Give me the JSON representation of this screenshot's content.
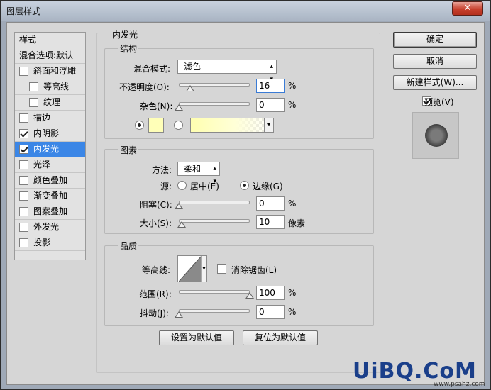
{
  "window": {
    "title": "图层样式",
    "close_glyph": "✕"
  },
  "style_list": {
    "header": "样式",
    "blend_options": "混合选项:默认",
    "items": [
      {
        "label": "斜面和浮雕",
        "checked": false
      },
      {
        "label": "等高线",
        "checked": false
      },
      {
        "label": "纹理",
        "checked": false
      },
      {
        "label": "描边",
        "checked": false
      },
      {
        "label": "内阴影",
        "checked": true
      },
      {
        "label": "内发光",
        "checked": true,
        "selected": true
      },
      {
        "label": "光泽",
        "checked": false
      },
      {
        "label": "颜色叠加",
        "checked": false
      },
      {
        "label": "渐变叠加",
        "checked": false
      },
      {
        "label": "图案叠加",
        "checked": false
      },
      {
        "label": "外发光",
        "checked": false
      },
      {
        "label": "投影",
        "checked": false
      }
    ]
  },
  "inner_glow": {
    "title": "内发光",
    "structure": {
      "title": "结构",
      "blend_mode_label": "混合模式:",
      "blend_mode_value": "滤色",
      "opacity_label": "不透明度(O):",
      "opacity_value": "16",
      "opacity_unit": "%",
      "opacity_level": 0.16,
      "noise_label": "杂色(N):",
      "noise_value": "0",
      "noise_unit": "%",
      "noise_level": 0,
      "color_swatch": "#ffffb8",
      "gradient_arrow": "▾"
    },
    "elements": {
      "title": "图素",
      "technique_label": "方法:",
      "technique_value": "柔和",
      "source_label": "源:",
      "source_center": "居中(E)",
      "source_edge": "边缘(G)",
      "choke_label": "阻塞(C):",
      "choke_value": "0",
      "choke_unit": "%",
      "choke_level": 0,
      "size_label": "大小(S):",
      "size_value": "10",
      "size_unit": "像素",
      "size_level": 0.04
    },
    "quality": {
      "title": "品质",
      "contour_label": "等高线:",
      "antialias_label": "消除锯齿(L)",
      "range_label": "范围(R):",
      "range_value": "100",
      "range_unit": "%",
      "range_level": 1.0,
      "jitter_label": "抖动(J):",
      "jitter_value": "0",
      "jitter_unit": "%",
      "jitter_level": 0
    },
    "make_default": "设置为默认值",
    "reset_default": "复位为默认值"
  },
  "buttons": {
    "ok": "确定",
    "cancel": "取消",
    "new_style": "新建样式(W)...",
    "preview_label": "预览(V)"
  },
  "watermark": {
    "main": "UiBQ.CoM",
    "sub": "www.psahz.com"
  }
}
